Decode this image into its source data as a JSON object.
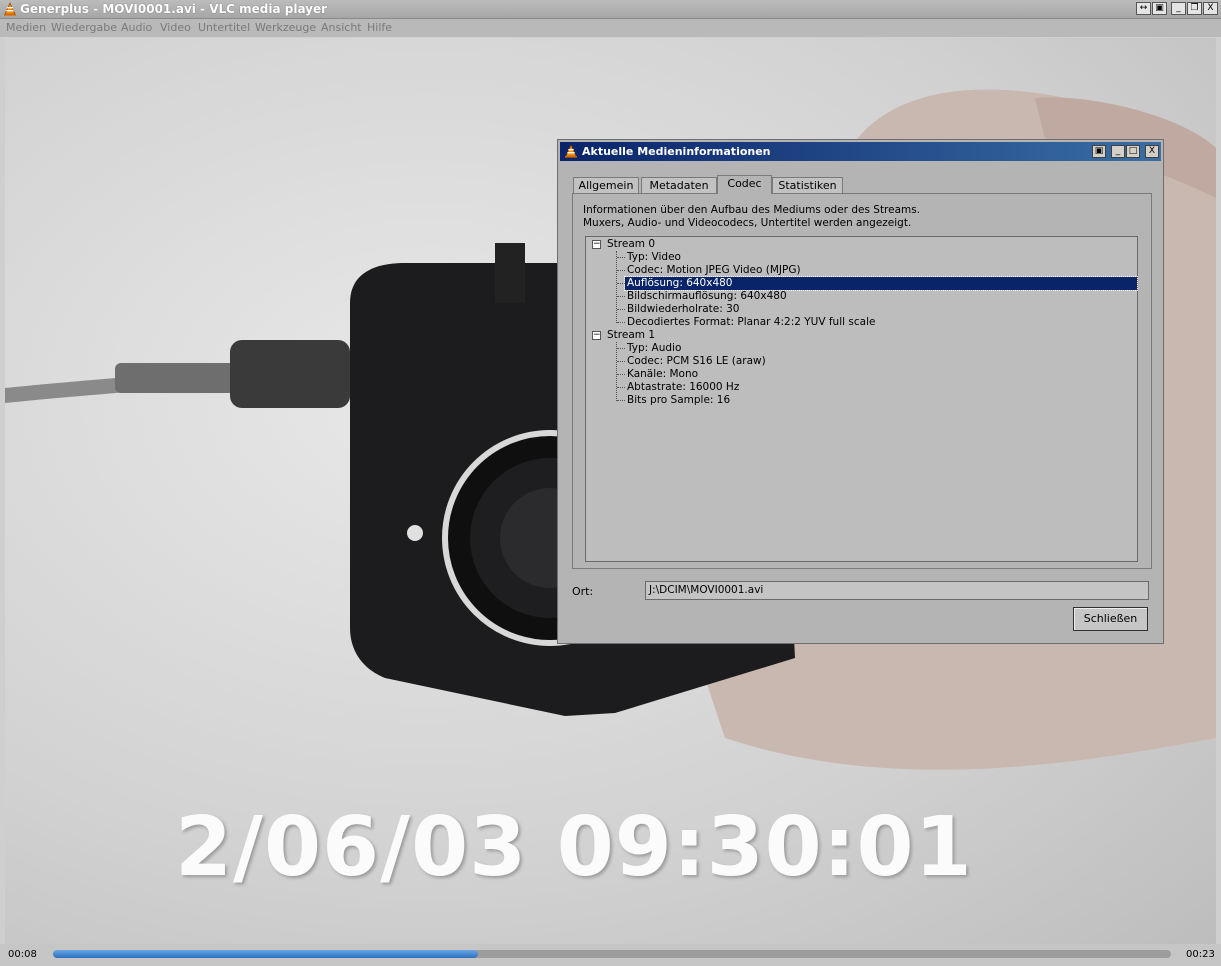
{
  "window": {
    "title": "Generplus - MOVI0001.avi - VLC media player",
    "buttons": [
      "↔",
      "▣",
      "_",
      "❐",
      "X"
    ]
  },
  "menu": [
    "Medien",
    "Wiedergabe",
    "Audio",
    "Video",
    "Untertitel",
    "Werkzeuge",
    "Ansicht",
    "Hilfe"
  ],
  "video": {
    "osd_timestamp": "2/06/03 09:30:01"
  },
  "playback": {
    "elapsed": "00:08",
    "total": "00:23",
    "progress": 0.38
  },
  "dialog": {
    "title": "Aktuelle Medieninformationen",
    "buttons": [
      "▣",
      "_",
      "□",
      "X"
    ],
    "tabs": [
      "Allgemein",
      "Metadaten",
      "Codec",
      "Statistiken"
    ],
    "active_tab": "Codec",
    "description_line1": "Informationen über den Aufbau des Mediums oder des Streams.",
    "description_line2": "Muxers, Audio- und Videocodecs, Untertitel werden angezeigt.",
    "streams": [
      {
        "label": "Stream 0",
        "items": [
          "Typ: Video",
          "Codec: Motion JPEG Video (MJPG)",
          "Auflösung: 640x480",
          "Bildschirmauflösung: 640x480",
          "Bildwiederholrate: 30",
          "Decodiertes Format: Planar 4:2:2 YUV full scale"
        ]
      },
      {
        "label": "Stream 1",
        "items": [
          "Typ: Audio",
          "Codec: PCM S16 LE (araw)",
          "Kanäle: Mono",
          "Abtastrate: 16000 Hz",
          "Bits pro Sample: 16"
        ]
      }
    ],
    "selected_item": "Auflösung: 640x480",
    "location_label": "Ort:",
    "location_value": "J:\\DCIM\\MOVI0001.avi",
    "close_label": "Schließen"
  }
}
